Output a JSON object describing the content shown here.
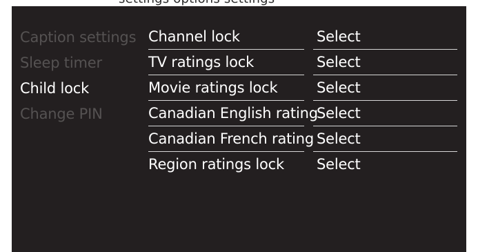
{
  "header": {
    "title_fragment": "settings options settings"
  },
  "sidebar": {
    "items": [
      {
        "label": "Caption settings",
        "state": "dim"
      },
      {
        "label": "Sleep timer",
        "state": "dim"
      },
      {
        "label": "Child lock",
        "state": "active"
      },
      {
        "label": "Change PIN",
        "state": "dim"
      }
    ]
  },
  "menu": {
    "rows": [
      {
        "label": "Channel lock",
        "value": "Select"
      },
      {
        "label": "TV ratings lock",
        "value": "Select"
      },
      {
        "label": "Movie ratings lock",
        "value": "Select"
      },
      {
        "label": "Canadian English rating",
        "value": "Select"
      },
      {
        "label": "Canadian French rating",
        "value": "Select"
      },
      {
        "label": "Region ratings lock",
        "value": "Select"
      }
    ]
  },
  "colors": {
    "panel_background": "#231f20",
    "active_text": "#ffffff",
    "dim_text": "#555252",
    "divider": "#d8d8d8"
  }
}
